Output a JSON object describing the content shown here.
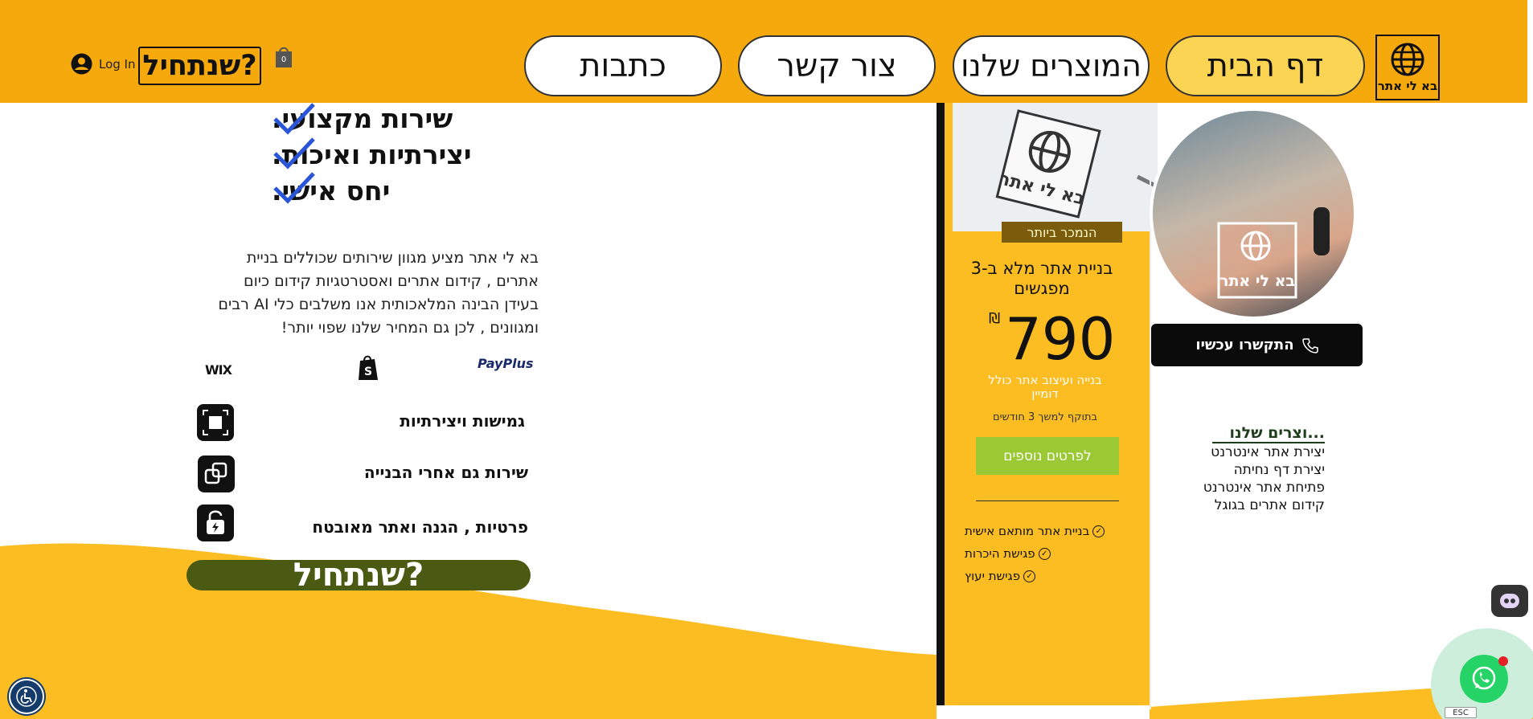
{
  "header": {
    "logo_text": "בא לי אתר",
    "nav": [
      {
        "label": "דף הבית",
        "active": true
      },
      {
        "label": "המוצרים שלנו",
        "active": false
      },
      {
        "label": "צור קשר",
        "active": false
      },
      {
        "label": "כתבות",
        "active": false
      }
    ],
    "start_button": "שנתחיל?",
    "login_label": "Log In",
    "cart_count": "0"
  },
  "features_top": {
    "items": [
      "שירות מקצועי.",
      "יצירתיות ואיכות.",
      "יחס אישי."
    ]
  },
  "intro_paragraph": "בא לי אתר מציע מגוון שירותים שכוללים בניית אתרים , קידום אתרים ואסטרטגיות קידום כיום בעידן הבינה המלאכותית אנו משלבים כלי AI רבים ומגוונים , לכן גם המחיר שלנו שפוי יותר!",
  "partners": [
    "PayPlus",
    "WIX"
  ],
  "features_list": [
    {
      "label": "גמישות ויצירתיות",
      "icon": "expand-icon"
    },
    {
      "label": "שירות גם אחרי הבנייה",
      "icon": "copy-icon"
    },
    {
      "label": "פרטיות , הגנה ואתר מאובטח",
      "icon": "lock-icon"
    }
  ],
  "start_button_bottom": "שנתחיל?",
  "pricing": {
    "badge": "הנמכר ביותר",
    "image_logo_text": "בא לי אתר",
    "title": "בניית אתר מלא ב-3 מפגשים",
    "price": "790",
    "currency": "₪",
    "description": "בנייה ועיצוב אתר כולל דומיין",
    "validity": "בתוקף למשך 3 חודשים",
    "more_button": "לפרטים נוספים",
    "perks": [
      "בניית אתר מותאם אישית",
      "פגישת היכרות",
      "פגישת יעוץ"
    ]
  },
  "profile": {
    "avatar_logo_text": "בא לי אתר",
    "call_button": "התקשרו עכשיו"
  },
  "products": {
    "title": "...וצרים שלנו",
    "items": [
      "יצירת אתר אינטרנט",
      "יצירת דף נחיתה",
      "פתיחת אתר אינטרנט",
      "קידום אתרים בגוגל"
    ]
  },
  "widgets": {
    "esc_label": "ESC"
  },
  "colors": {
    "header_bg": "#f5a90d",
    "wave": "#fbbd22",
    "active_nav": "#fcd453",
    "start_bottom": "#4a5a12",
    "more_button": "#9bc934",
    "whatsapp": "#25d366"
  }
}
